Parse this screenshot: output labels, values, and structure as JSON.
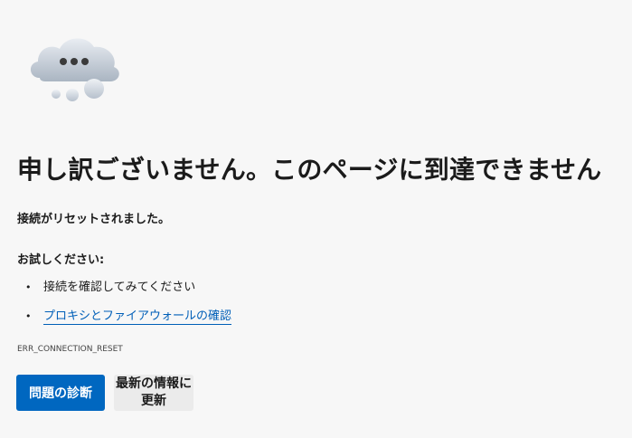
{
  "error_page": {
    "illustration_icon": "cloud-with-dots-icon",
    "title": "申し訳ございません。このページに到達できません",
    "subtitle": "接続がリセットされました。",
    "try_label": "お試しください:",
    "suggestions": [
      {
        "text": "接続を確認してみてください",
        "is_link": false
      },
      {
        "text": "プロキシとファイアウォールの確認",
        "is_link": true
      }
    ],
    "error_code": "ERR_CONNECTION_RESET",
    "diagnose_button_label": "問題の診断",
    "refresh_button_label": "最新の情報に更新"
  },
  "colors": {
    "background": "#f7f7f7",
    "primary_button": "#0067c0",
    "link": "#005fb8",
    "secondary_button": "#ebebeb"
  }
}
